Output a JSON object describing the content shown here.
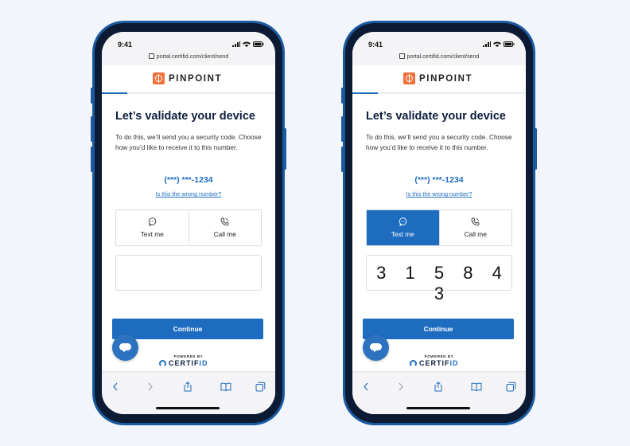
{
  "phones": [
    {
      "status": {
        "time": "9:41",
        "url": "portal.certifid.com/client/send"
      },
      "brand": {
        "name": "PINPOINT"
      },
      "title": "Let’s validate your device",
      "description": "To do this, we’ll send you a security code. Choose how you’d like to receive it to this number.",
      "phone_number": "(***) ***-1234",
      "wrong_number_link": "Is this the wrong number?",
      "options": [
        {
          "label": "Text me",
          "icon": "chat-icon",
          "selected": false
        },
        {
          "label": "Call me",
          "icon": "phone-icon",
          "selected": false
        }
      ],
      "code": "",
      "continue_label": "Continue",
      "powered_by": "POWERED BY",
      "footer_brand": {
        "main": "CERTIF",
        "accent": "ID"
      }
    },
    {
      "status": {
        "time": "9:41",
        "url": "portal.certifid.com/client/send"
      },
      "brand": {
        "name": "PINPOINT"
      },
      "title": "Let’s validate your device",
      "description": "To do this, we’ll send you a security code. Choose how you’d like to receive it to this number.",
      "phone_number": "(***) ***-1234",
      "wrong_number_link": "Is this the wrong number?",
      "options": [
        {
          "label": "Text me",
          "icon": "chat-icon",
          "selected": true
        },
        {
          "label": "Call me",
          "icon": "phone-icon",
          "selected": false
        }
      ],
      "code": "3 1 5 8 4 3",
      "continue_label": "Continue",
      "powered_by": "POWERED BY",
      "footer_brand": {
        "main": "CERTIF",
        "accent": "ID"
      }
    }
  ],
  "colors": {
    "accent": "#1e6cc0",
    "brand_orange": "#f1703a",
    "title": "#0e1e3d",
    "phone_shell": "#1a5aa0",
    "background": "#f2f5fc"
  }
}
